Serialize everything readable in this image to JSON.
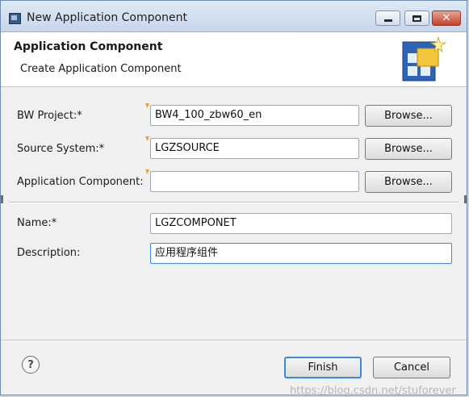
{
  "window": {
    "title": "New Application Component"
  },
  "banner": {
    "title": "Application Component",
    "subtitle": "Create Application Component"
  },
  "form": {
    "bw_project": {
      "label": "BW Project:*",
      "value": "BW4_100_zbw60_en",
      "browse_label": "Browse..."
    },
    "source_system": {
      "label": "Source System:*",
      "value": "LGZSOURCE",
      "browse_label": "Browse..."
    },
    "application_component": {
      "label": "Application Component:",
      "value": "",
      "browse_label": "Browse..."
    },
    "name": {
      "label": "Name:*",
      "value": "LGZCOMPONET"
    },
    "description": {
      "label": "Description:",
      "value": "应用程序组件"
    }
  },
  "footer": {
    "help_glyph": "?",
    "finish_label": "Finish",
    "cancel_label": "Cancel"
  },
  "watermark": "https://blog.csdn.net/stuforever",
  "colors": {
    "accent": "#3b8ad9",
    "required_marker": "#e8a23a",
    "title_bar": "#c7d7ea"
  }
}
